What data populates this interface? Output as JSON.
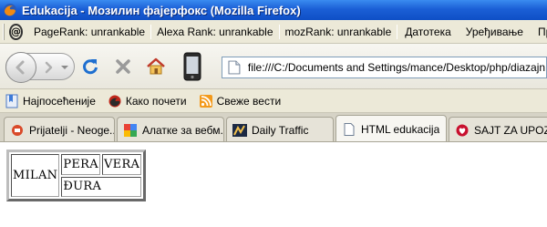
{
  "window": {
    "title": "Edukacija - Мозилин фајерфокс (Mozilla Firefox)"
  },
  "menubar": {
    "seo_icon": "seo-toolbar-icon",
    "pagerank": "PageRank: unrankable",
    "alexa": "Alexa Rank: unrankable",
    "mozrank": "mozRank: unrankable",
    "menus": [
      "Датотека",
      "Уређивање",
      "Приказ"
    ]
  },
  "navbar": {
    "url": "file:///C:/Documents and Settings/mance/Desktop/php/diazajn za nov",
    "icons": [
      "back-icon",
      "forward-icon",
      "reload-icon",
      "stop-icon",
      "home-icon",
      "phone-icon",
      "page-icon"
    ]
  },
  "bookmarks": [
    {
      "label": "Најпосећеније",
      "icon": "bookmark-icon"
    },
    {
      "label": "Како почети",
      "icon": "firefox-icon"
    },
    {
      "label": "Свеже вести",
      "icon": "rss-icon"
    }
  ],
  "tabs": [
    {
      "label": "Prijatelji - Neoge...",
      "icon": "globe-icon"
    },
    {
      "label": "Алатке за вебм...",
      "icon": "google-icon"
    },
    {
      "label": "Daily Traffic",
      "icon": "traffic-icon"
    },
    {
      "label": "HTML edukacija",
      "icon": "page-icon"
    },
    {
      "label": "SAJT ZA UPOZN...",
      "icon": "heart-icon"
    }
  ],
  "table": {
    "cell_milan": "MILAN",
    "cell_pera": "PERA",
    "cell_vera": "VERA",
    "cell_djura": "ĐURA"
  },
  "colors": {
    "titlebar": "#1b5fd6",
    "chrome": "#ece9d8",
    "reload": "#1e6fd0",
    "stop": "#9a9a9a"
  }
}
